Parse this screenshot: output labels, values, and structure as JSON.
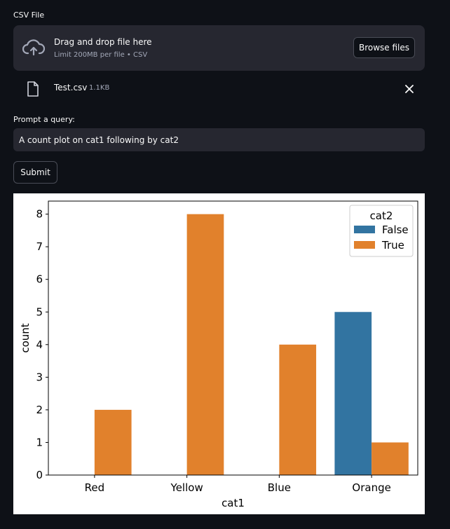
{
  "uploader": {
    "label": "CSV File",
    "drop_title": "Drag and drop file here",
    "drop_subtitle": "Limit 200MB per file • CSV",
    "browse_label": "Browse files",
    "upload_icon": "cloud-upload-icon"
  },
  "file": {
    "name": "Test.csv",
    "size": "1.1KB",
    "file_icon": "file-icon",
    "remove_icon": "close-icon"
  },
  "query": {
    "label": "Prompt a query:",
    "value": "A count plot on cat1 following by cat2"
  },
  "submit_label": "Submit",
  "colors": {
    "background": "#0e1117",
    "panel": "#262730",
    "series_false": "#3274a1",
    "series_true": "#e1812c"
  },
  "chart_data": {
    "type": "bar",
    "categories": [
      "Red",
      "Yellow",
      "Blue",
      "Orange"
    ],
    "series": [
      {
        "name": "False",
        "values": [
          0,
          0,
          0,
          5
        ]
      },
      {
        "name": "True",
        "values": [
          2,
          8,
          4,
          1
        ]
      }
    ],
    "xlabel": "cat1",
    "ylabel": "count",
    "ylim": [
      0,
      8.4
    ],
    "yticks": [
      0,
      1,
      2,
      3,
      4,
      5,
      6,
      7,
      8
    ],
    "legend_title": "cat2",
    "legend_position": "top-right",
    "grid": false
  }
}
